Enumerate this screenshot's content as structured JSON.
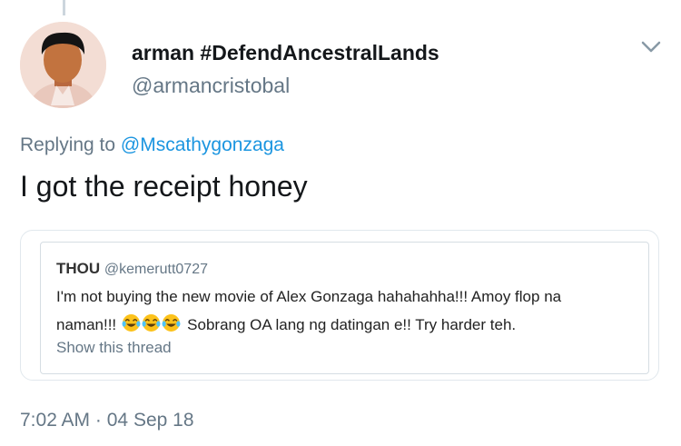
{
  "tweet": {
    "display_name": "arman #DefendAncestralLands",
    "handle": "@armancristobal",
    "replying_prefix": "Replying to",
    "replying_to": "@Mscathygonzaga",
    "text": "I got the receipt honey",
    "timestamp": "7:02 AM",
    "separator": "·",
    "date": "04 Sep 18"
  },
  "quote": {
    "name": "THOU",
    "handle": "@kemerutt0727",
    "line1": "I'm not buying the new movie of Alex Gonzaga hahahahha!!! Amoy flop na",
    "line2_before": "naman!!!",
    "line2_after": "Sobrang OA lang ng datingan e!! Try harder teh.",
    "emoji_count": 3,
    "emoji_name": "tears-of-joy-emoji",
    "show_thread": "Show this thread"
  },
  "icons": {
    "menu": "chevron-down-icon",
    "avatar": "avatar"
  },
  "colors": {
    "link": "#1b95e0",
    "secondary_text": "#657786",
    "primary_text": "#14171a",
    "border": "#e1e8ed"
  }
}
